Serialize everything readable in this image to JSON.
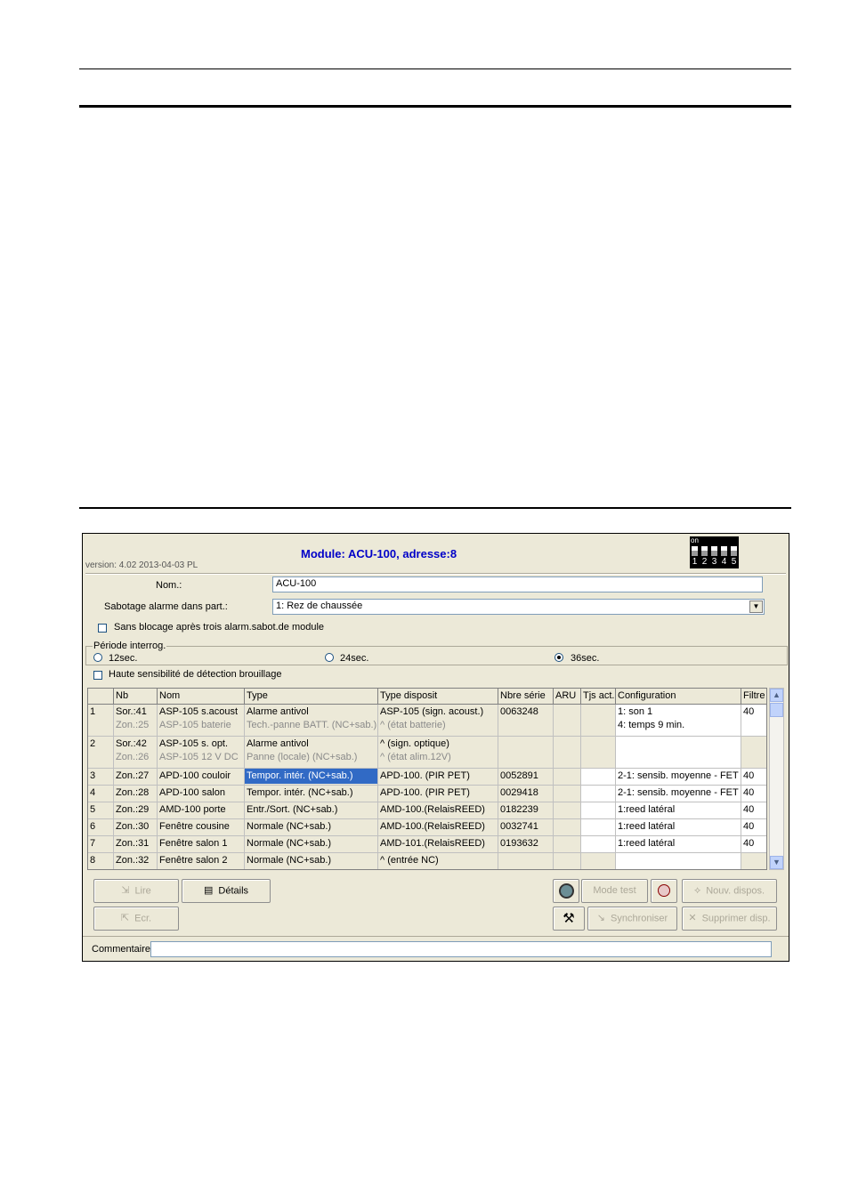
{
  "window": {
    "version": "version: 4.02 2013-04-03 PL",
    "title": "Module: ACU-100, adresse:8",
    "dip": {
      "on_label": "on",
      "numbers": [
        "1",
        "2",
        "3",
        "4",
        "5"
      ]
    }
  },
  "form": {
    "nom_label": "Nom.:",
    "nom_value": "ACU-100",
    "sabotage_label": "Sabotage alarme dans part.:",
    "sabotage_value": "1: Rez de chaussée",
    "blocage_label": "Sans blocage après trois alarm.sabot.de module",
    "periode_label": "Période interrog.",
    "periode_options": [
      "12sec.",
      "24sec.",
      "36sec."
    ],
    "periode_selected": "36sec.",
    "haute_label": "Haute sensibilité de détection brouillage"
  },
  "grid": {
    "columns": [
      "",
      "Nb",
      "Nom",
      "Type",
      "Type disposit",
      "Nbre série",
      "ARU",
      "Tjs act.",
      "Configuration",
      "Filtre"
    ],
    "rows": [
      {
        "idx": "1",
        "nb": "Sor.:41",
        "nb2": "Zon.:25",
        "nom": "ASP-105 s.acoust",
        "nom2": "ASP-105 baterie",
        "type": "Alarme antivol",
        "type2": "Tech.-panne BATT. (NC+sab.)",
        "disp": "ASP-105 (sign. acoust.)",
        "disp2": "^            (état batterie)",
        "serie": "0063248",
        "config": "1: son 1",
        "config2": "4: temps 9 min.",
        "filtre": "40"
      },
      {
        "idx": "2",
        "nb": "Sor.:42",
        "nb2": "Zon.:26",
        "nom": "ASP-105 s. opt.",
        "nom2": "ASP-105 12 V DC",
        "type": "Alarme antivol",
        "type2": "Panne (locale) (NC+sab.)",
        "disp": "^            (sign. optique)",
        "disp2": "^            (état alim.12V)",
        "serie": "",
        "config": "",
        "config2": "",
        "filtre": ""
      },
      {
        "idx": "3",
        "nb": "Zon.:27",
        "nom": "APD-100 couloir",
        "type": "Tempor. intér. (NC+sab.)",
        "disp": "APD-100. (PIR PET)",
        "serie": "0052891",
        "config": "2-1: sensib. moyenne - FET",
        "filtre": "40"
      },
      {
        "idx": "4",
        "nb": "Zon.:28",
        "nom": "APD-100 salon",
        "type": "Tempor. intér. (NC+sab.)",
        "disp": "APD-100. (PIR PET)",
        "serie": "0029418",
        "config": "2-1: sensib. moyenne - FET",
        "filtre": "40"
      },
      {
        "idx": "5",
        "nb": "Zon.:29",
        "nom": "AMD-100 porte",
        "type": "Entr./Sort. (NC+sab.)",
        "disp": "AMD-100.(RelaisREED)",
        "serie": "0182239",
        "config": "1:reed latéral",
        "filtre": "40"
      },
      {
        "idx": "6",
        "nb": "Zon.:30",
        "nom": "Fenêtre cousine",
        "type": "Normale (NC+sab.)",
        "disp": "AMD-100.(RelaisREED)",
        "serie": "0032741",
        "config": "1:reed latéral",
        "filtre": "40"
      },
      {
        "idx": "7",
        "nb": "Zon.:31",
        "nom": "Fenêtre salon 1",
        "type": "Normale (NC+sab.)",
        "disp": "AMD-101.(RelaisREED)",
        "serie": "0193632",
        "config": "1:reed latéral",
        "filtre": "40"
      },
      {
        "idx": "8",
        "nb": "Zon.:32",
        "nom": "Fenêtre salon 2",
        "type": "Normale (NC+sab.)",
        "disp": "^            (entrée NC)",
        "serie": "",
        "config": "",
        "filtre": ""
      }
    ]
  },
  "buttons": {
    "lire": "Lire",
    "details": "Détails",
    "ecrire": "Ecr.",
    "mode_test": "Mode test",
    "nouv_dispos": "Nouv. dispos.",
    "synchroniser": "Synchroniser",
    "supprimer": "Supprimer disp."
  },
  "comment": {
    "label": "Commentaire:",
    "value": ""
  },
  "colors": {
    "title": "#0000c8",
    "selection": "#316ac5",
    "window_bg": "#ece9d8"
  }
}
